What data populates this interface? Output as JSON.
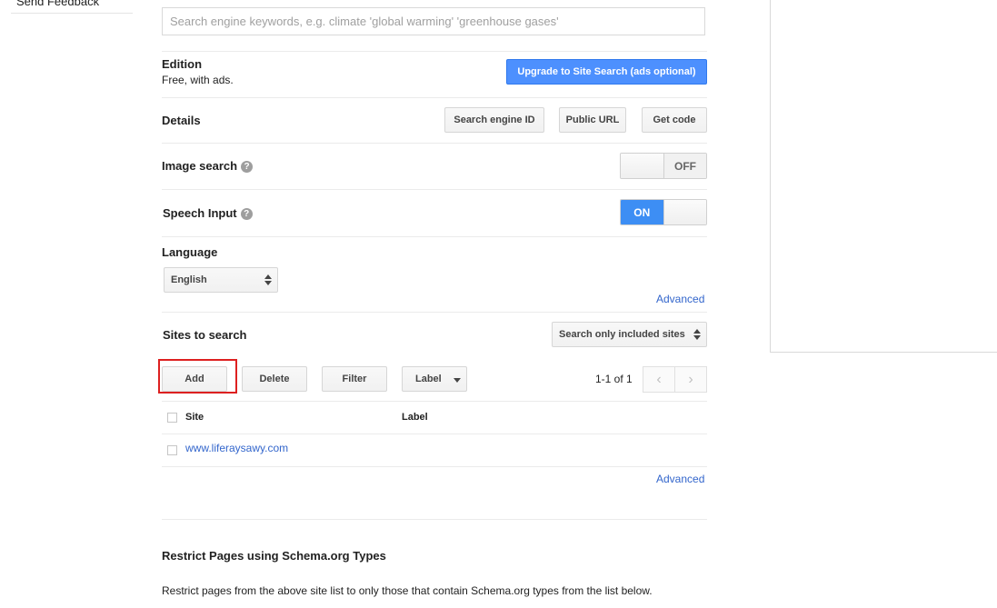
{
  "left_nav": {
    "send_feedback": "Send Feedback"
  },
  "keywords": {
    "placeholder": "Search engine keywords, e.g. climate 'global warming' 'greenhouse gases'",
    "value": ""
  },
  "edition": {
    "title": "Edition",
    "value": "Free, with ads.",
    "upgrade_button": "Upgrade to Site Search (ads optional)"
  },
  "details": {
    "title": "Details",
    "buttons": [
      "Search engine ID",
      "Public URL",
      "Get code"
    ]
  },
  "image_search": {
    "title": "Image search",
    "help_icon": "?",
    "state": "OFF"
  },
  "speech_input": {
    "title": "Speech Input",
    "help_icon": "?",
    "state": "ON"
  },
  "language": {
    "title": "Language",
    "selected": "English",
    "advanced_link": "Advanced"
  },
  "sites": {
    "title": "Sites to search",
    "scope_selected": "Search only included sites",
    "actions": {
      "add": "Add",
      "delete": "Delete",
      "filter": "Filter",
      "label": "Label"
    },
    "pagination": {
      "text": "1-1 of 1",
      "prev": "‹",
      "next": "›"
    },
    "columns": {
      "site": "Site",
      "label": "Label"
    },
    "rows": [
      {
        "site": "www.liferaysawy.com",
        "label": ""
      }
    ],
    "advanced_link": "Advanced"
  },
  "schema": {
    "title": "Restrict Pages using Schema.org Types",
    "description": "Restrict pages from the above site list to only those that contain Schema.org types from the list below."
  },
  "colors": {
    "accent": "#4d90fe",
    "link": "#3366cc",
    "highlight": "#dd2020",
    "toggle_on": "#3d8ef4"
  }
}
